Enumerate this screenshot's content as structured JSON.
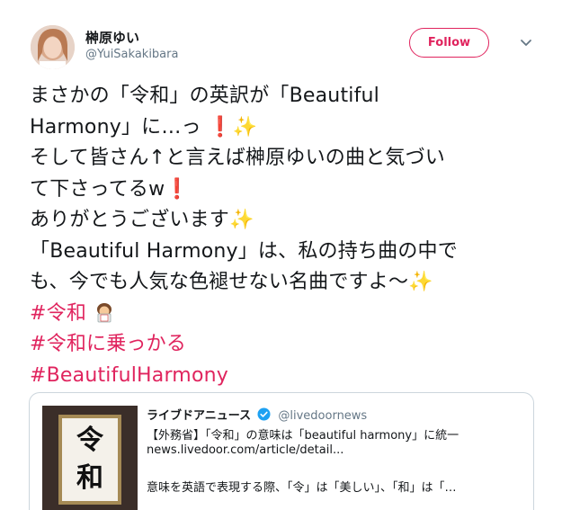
{
  "author": {
    "name": "榊原ゆい",
    "handle": "@YuiSakakibara"
  },
  "follow_label": "Follow",
  "tweet": {
    "line1": "まさかの「令和」の英訳が「Beautiful",
    "line2_text": "Harmony」に…っ",
    "line3": "そして皆さん↑と言えば榊原ゆいの曲と気づい",
    "line4_text": "て下さってるw",
    "line5_text": "ありがとうございます",
    "line6": "「Beautiful Harmony」は、私の持ち曲の中で",
    "line7_text": "も、今でも人気な色褪せない名曲ですよ〜",
    "hashtags": [
      "#令和",
      "#令和に乗っかる",
      "#BeautifulHarmony"
    ],
    "emoji_exclamation": "❗",
    "emoji_sparkles": "✨"
  },
  "card": {
    "source_name": "ライブドアニュース",
    "source_handle": "@livedoornews",
    "headline": "【外務省】「令和」の意味は「beautiful harmony」に統一",
    "url": "news.livedoor.com/article/detail...",
    "snippet": "意味を英語で表現する際、「令」は「美しい」、「和」は「…",
    "thumb_text": "令和"
  },
  "colors": {
    "accent": "#e0245e",
    "text": "#14171a",
    "muted": "#657786",
    "verified": "#1da1f2"
  }
}
